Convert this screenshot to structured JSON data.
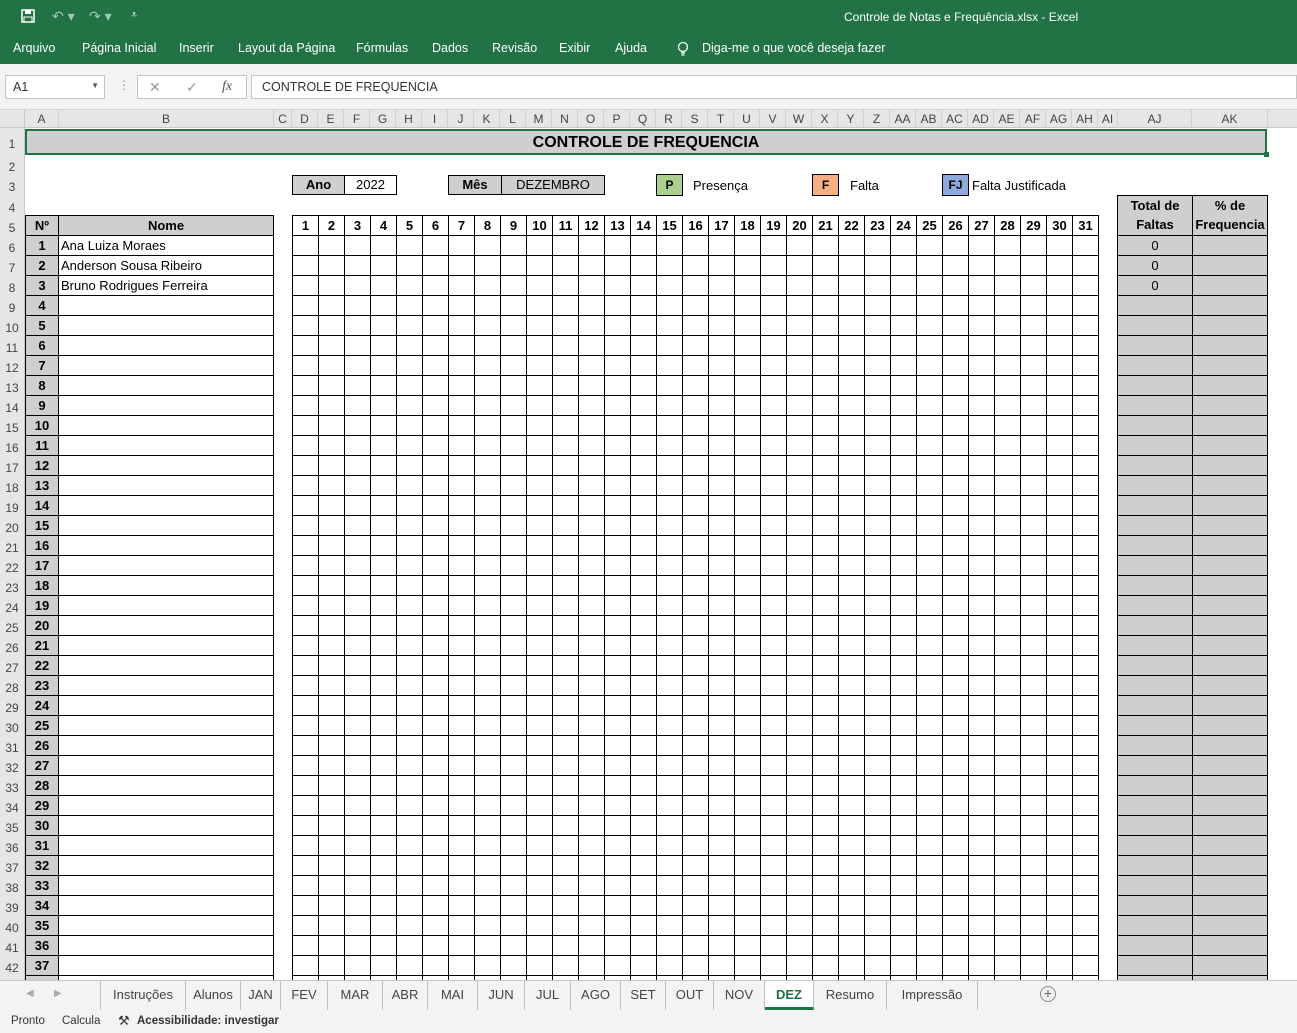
{
  "window": {
    "title": "Controle de Notas e Frequência.xlsx  -  Excel"
  },
  "menu": [
    "Arquivo",
    "Página Inicial",
    "Inserir",
    "Layout da Página",
    "Fórmulas",
    "Dados",
    "Revisão",
    "Exibir",
    "Ajuda"
  ],
  "tell_me": "Diga-me o que você deseja fazer",
  "formula_bar": {
    "cell_ref": "A1",
    "content": "CONTROLE DE FREQUENCIA",
    "fx": "fx"
  },
  "columns": [
    "A",
    "B",
    "C",
    "D",
    "E",
    "F",
    "G",
    "H",
    "I",
    "J",
    "K",
    "L",
    "M",
    "N",
    "O",
    "P",
    "Q",
    "R",
    "S",
    "T",
    "U",
    "V",
    "W",
    "X",
    "Y",
    "Z",
    "AA",
    "AB",
    "AC",
    "AD",
    "AE",
    "AF",
    "AG",
    "AH",
    "AI",
    "AJ",
    "AK"
  ],
  "sheet": {
    "title": "CONTROLE DE FREQUENCIA",
    "ano_label": "Ano",
    "ano_value": "2022",
    "mes_label": "Mês",
    "mes_value": "DEZEMBRO",
    "legend": [
      {
        "code": "P",
        "label": "Presença",
        "color": "#a9d08e"
      },
      {
        "code": "F",
        "label": "Falta",
        "color": "#f4b084"
      },
      {
        "code": "FJ",
        "label": "Falta Justificada",
        "color": "#8ea9db"
      }
    ],
    "hdr_num": "Nº",
    "hdr_nome": "Nome",
    "hdr_total": "Total de Faltas",
    "hdr_total_l1": "Total de",
    "hdr_total_l2": "Faltas",
    "hdr_pct_l1": "% de",
    "hdr_pct_l2": "Frequencia",
    "days": [
      "1",
      "2",
      "3",
      "4",
      "5",
      "6",
      "7",
      "8",
      "9",
      "10",
      "11",
      "12",
      "13",
      "14",
      "15",
      "16",
      "17",
      "18",
      "19",
      "20",
      "21",
      "22",
      "23",
      "24",
      "25",
      "26",
      "27",
      "28",
      "29",
      "30",
      "31"
    ],
    "students": [
      {
        "num": "1",
        "name": "Ana Luiza Moraes",
        "total": "0"
      },
      {
        "num": "2",
        "name": "Anderson Sousa Ribeiro",
        "total": "0"
      },
      {
        "num": "3",
        "name": "Bruno Rodrigues Ferreira",
        "total": "0"
      },
      {
        "num": "4",
        "name": "",
        "total": ""
      },
      {
        "num": "5",
        "name": "",
        "total": ""
      },
      {
        "num": "6",
        "name": "",
        "total": ""
      },
      {
        "num": "7",
        "name": "",
        "total": ""
      },
      {
        "num": "8",
        "name": "",
        "total": ""
      },
      {
        "num": "9",
        "name": "",
        "total": ""
      },
      {
        "num": "10",
        "name": "",
        "total": ""
      },
      {
        "num": "11",
        "name": "",
        "total": ""
      },
      {
        "num": "12",
        "name": "",
        "total": ""
      },
      {
        "num": "13",
        "name": "",
        "total": ""
      },
      {
        "num": "14",
        "name": "",
        "total": ""
      },
      {
        "num": "15",
        "name": "",
        "total": ""
      },
      {
        "num": "16",
        "name": "",
        "total": ""
      },
      {
        "num": "17",
        "name": "",
        "total": ""
      },
      {
        "num": "18",
        "name": "",
        "total": ""
      },
      {
        "num": "19",
        "name": "",
        "total": ""
      },
      {
        "num": "20",
        "name": "",
        "total": ""
      },
      {
        "num": "21",
        "name": "",
        "total": ""
      },
      {
        "num": "22",
        "name": "",
        "total": ""
      },
      {
        "num": "23",
        "name": "",
        "total": ""
      },
      {
        "num": "24",
        "name": "",
        "total": ""
      },
      {
        "num": "25",
        "name": "",
        "total": ""
      },
      {
        "num": "26",
        "name": "",
        "total": ""
      },
      {
        "num": "27",
        "name": "",
        "total": ""
      },
      {
        "num": "28",
        "name": "",
        "total": ""
      },
      {
        "num": "29",
        "name": "",
        "total": ""
      },
      {
        "num": "30",
        "name": "",
        "total": ""
      },
      {
        "num": "31",
        "name": "",
        "total": ""
      },
      {
        "num": "32",
        "name": "",
        "total": ""
      },
      {
        "num": "33",
        "name": "",
        "total": ""
      },
      {
        "num": "34",
        "name": "",
        "total": ""
      },
      {
        "num": "35",
        "name": "",
        "total": ""
      },
      {
        "num": "36",
        "name": "",
        "total": ""
      },
      {
        "num": "37",
        "name": "",
        "total": ""
      }
    ]
  },
  "tabs": [
    "Instruções",
    "Alunos",
    "JAN",
    "FEV",
    "MAR",
    "ABR",
    "MAI",
    "JUN",
    "JUL",
    "AGO",
    "SET",
    "OUT",
    "NOV",
    "DEZ",
    "Resumo",
    "Impressão"
  ],
  "active_tab": "DEZ",
  "status": {
    "ready": "Pronto",
    "calc": "Calcula",
    "accessibility": "Acessibilidade: investigar"
  },
  "colors": {
    "excel_green": "#217346",
    "header_gray": "#d0cece"
  }
}
